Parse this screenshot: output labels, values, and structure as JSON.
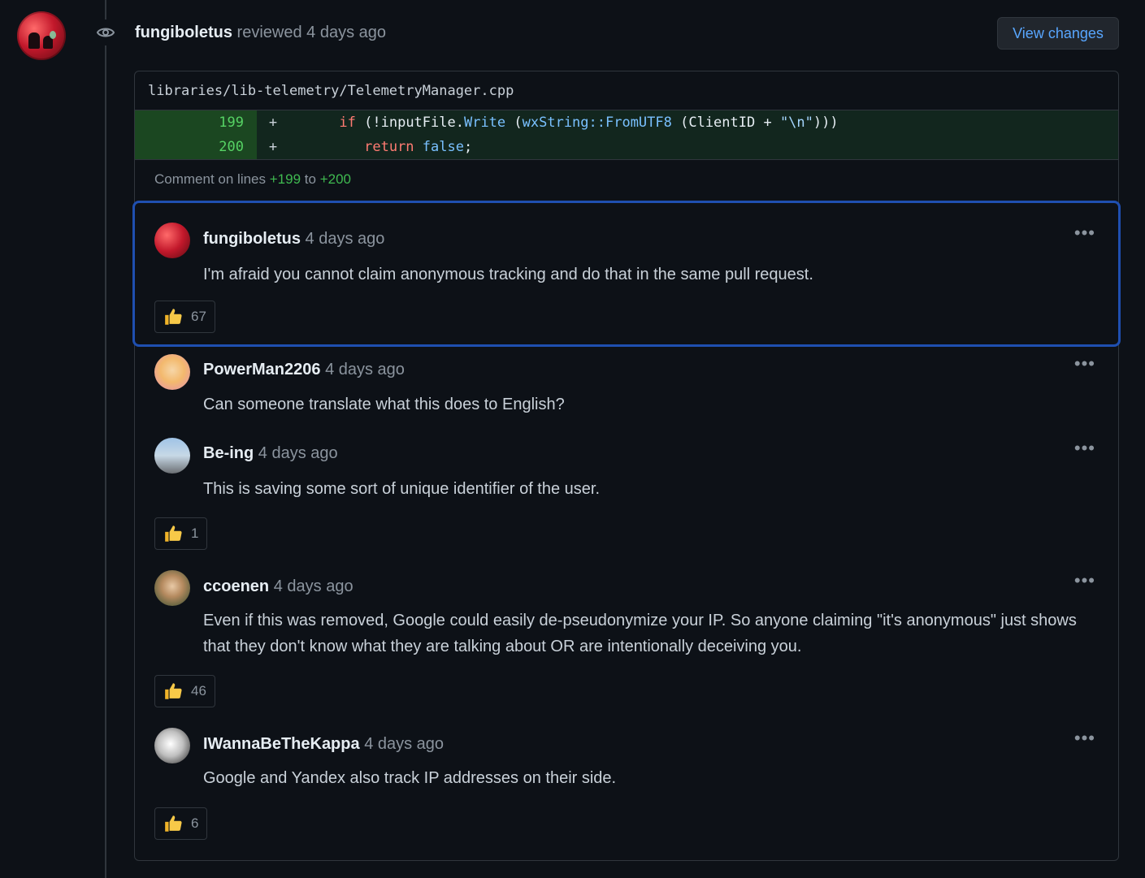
{
  "review": {
    "author": "fungiboletus",
    "action": "reviewed",
    "time": "4 days ago",
    "view_changes_label": "View changes"
  },
  "file": {
    "path": "libraries/lib-telemetry/TelemetryManager.cpp",
    "lines": [
      {
        "num": "199",
        "sign": "+"
      },
      {
        "num": "200",
        "sign": "+"
      }
    ],
    "comment_on": {
      "prefix": "Comment on lines",
      "start": "+199",
      "mid": "to",
      "end": "+200"
    }
  },
  "comments": [
    {
      "author": "fungiboletus",
      "time": "4 days ago",
      "body": "I'm afraid you cannot claim anonymous tracking and do that in the same pull request.",
      "reaction_count": "67"
    },
    {
      "author": "PowerMan2206",
      "time": "4 days ago",
      "body": "Can someone translate what this does to English?"
    },
    {
      "author": "Be-ing",
      "time": "4 days ago",
      "body": "This is saving some sort of unique identifier of the user.",
      "reaction_count": "1"
    },
    {
      "author": "ccoenen",
      "time": "4 days ago",
      "body": "Even if this was removed, Google could easily de-pseudonymize your IP. So anyone claiming \"it's anonymous\" just shows that they don't know what they are talking about OR are intentionally deceiving you.",
      "reaction_count": "46"
    },
    {
      "author": "IWannaBeTheKappa",
      "time": "4 days ago",
      "body": "Google and Yandex also track IP addresses on their side.",
      "reaction_count": "6"
    }
  ],
  "icons": {
    "eye": "eye-icon",
    "kebab": "kebab-horizontal-icon",
    "reaction": "thumbs-up-icon"
  },
  "colors": {
    "accent": "#58a6ff",
    "diff_add": "#3fb950",
    "highlight_border": "#1f4fb0"
  }
}
